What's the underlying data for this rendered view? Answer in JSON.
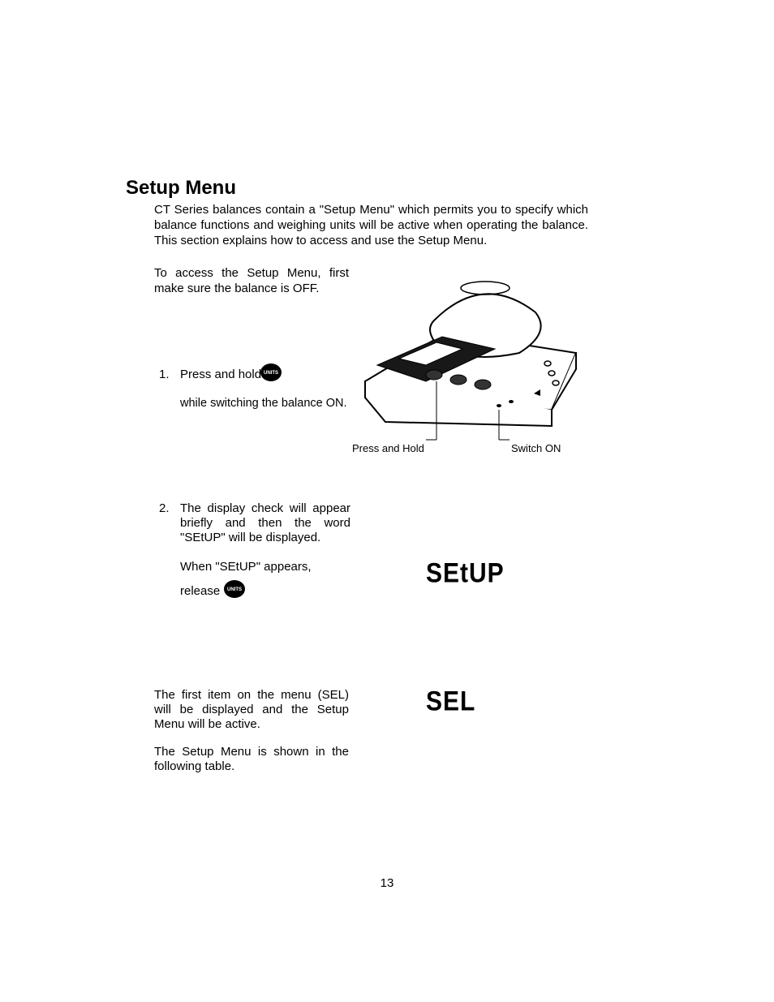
{
  "title": "Setup Menu",
  "intro": "CT Series balances contain a \"Setup Menu\" which permits you to specify which balance functions and weighing units will be active when operating the balance. This section explains how to access and use the Setup Menu.",
  "access": "To access the Setup Menu, first make sure the balance is OFF.",
  "step1": {
    "num": "1.",
    "a": "Press and hold",
    "b": "while switching the balance ON."
  },
  "figure": {
    "press_hold": "Press and Hold",
    "switch_on": "Switch ON"
  },
  "step2": {
    "num": "2.",
    "a": "The display check will appear briefly and then the word \"SEtUP\" will be displayed.",
    "b": "When \"SEtUP\" appears,",
    "c": "release"
  },
  "display": {
    "setup": "SEtUP",
    "sel": "SEL"
  },
  "step3": "The first item on the menu (SEL) will be displayed and the Setup Menu will be active.",
  "step4": "The Setup Menu is shown in the following table.",
  "page_number": "13",
  "icons": {
    "units_button": "UNITS"
  }
}
